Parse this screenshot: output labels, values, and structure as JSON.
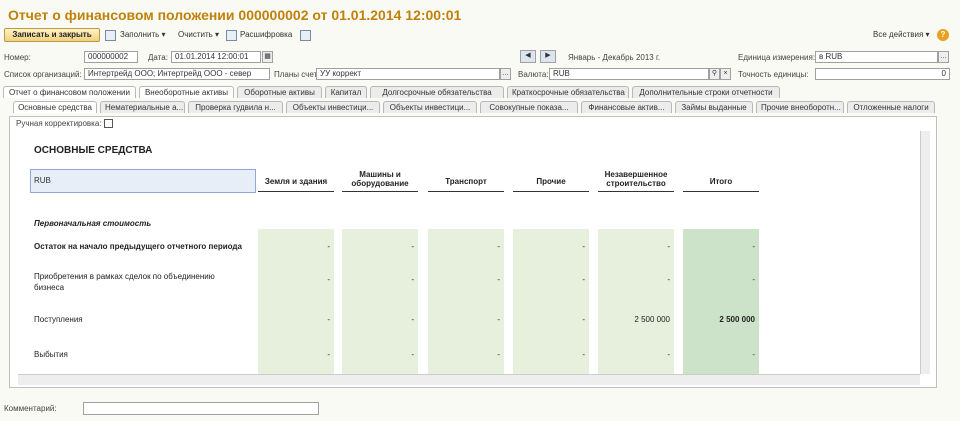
{
  "window": {
    "title": "Отчет о финансовом положении 000000002 от 01.01.2014 12:00:01"
  },
  "toolbar": {
    "save_close": "Записать и закрыть",
    "fill": "Заполнить",
    "clear": "Очистить",
    "decode": "Расшифровка",
    "all_actions": "Все действия"
  },
  "form": {
    "number_label": "Номер:",
    "number": "000000002",
    "date_label": "Дата:",
    "date": "01.01.2014 12:00:01",
    "period": "Январь - Декабрь 2013 г.",
    "unit_label": "Единица измерения:",
    "unit": "в RUB",
    "orgs_label": "Список организаций:",
    "orgs": "Интертрейд ООО; Интертрейд ООО - север",
    "accounts_label": "Планы счетов:",
    "accounts": "УУ коррект",
    "currency_label": "Валюта:",
    "currency": "RUB",
    "precision_label": "Точность единицы:",
    "precision": "0"
  },
  "tabs_top": [
    "Отчет о финансовом положении",
    "Внеоборотные активы",
    "Оборотные активы",
    "Капитал",
    "Долгосрочные обязательства",
    "Краткосрочные обязательства",
    "Дополнительные строки отчетности"
  ],
  "tabs_sub": [
    "Основные средства",
    "Нематериальные а...",
    "Проверка гудвила н...",
    "Объекты инвестици...",
    "Объекты инвестици...",
    "Совокупные показа...",
    "Финансовые актив...",
    "Займы выданные",
    "Прочие внеоборотн...",
    "Отложенные налоги"
  ],
  "manual_label": "Ручная корректировка:",
  "sheet": {
    "title": "ОСНОВНЫЕ СРЕДСТВА",
    "currency_cell": "RUB",
    "columns": [
      "Земля и здания",
      "Машины и оборудование",
      "Транспорт",
      "Прочие",
      "Незавершенное строительство",
      "Итого"
    ],
    "section": "Первоначальная стоимость",
    "rows": [
      {
        "label": "Остаток на начало предыдущего отчетного периода",
        "values": [
          "-",
          "-",
          "-",
          "-",
          "-",
          "-"
        ]
      },
      {
        "label": "Приобретения в рамках сделок по объединению бизнеса",
        "values": [
          "-",
          "-",
          "-",
          "-",
          "-",
          "-"
        ]
      },
      {
        "label": "Поступления",
        "values": [
          "-",
          "-",
          "-",
          "-",
          "2 500 000",
          "2 500 000"
        ]
      },
      {
        "label": "Выбытия",
        "values": [
          "-",
          "-",
          "-",
          "-",
          "-",
          "-"
        ]
      }
    ]
  },
  "comment_label": "Комментарий:",
  "colors": {
    "accent": "#c0810a",
    "cell": "#e6f0dc",
    "total": "#cde3c9"
  }
}
